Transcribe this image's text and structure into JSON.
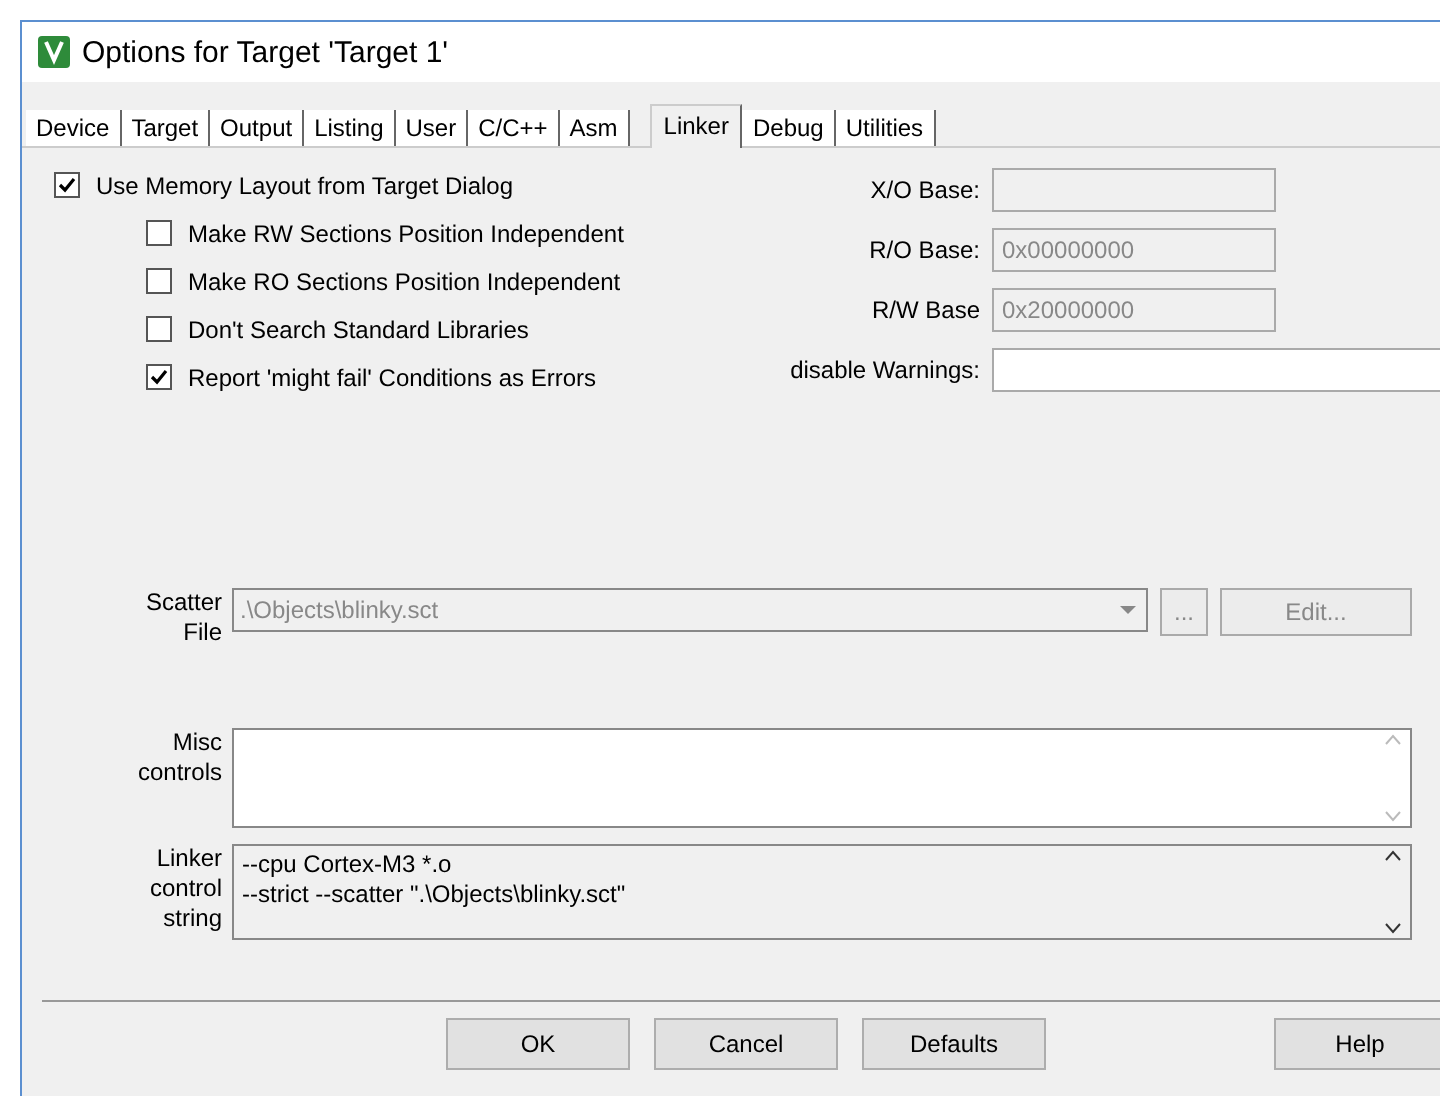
{
  "window": {
    "title": "Options for Target 'Target 1'"
  },
  "tabs": [
    {
      "label": "Device",
      "selected": false
    },
    {
      "label": "Target",
      "selected": false
    },
    {
      "label": "Output",
      "selected": false
    },
    {
      "label": "Listing",
      "selected": false
    },
    {
      "label": "User",
      "selected": false
    },
    {
      "label": "C/C++",
      "selected": false
    },
    {
      "label": "Asm",
      "selected": false
    },
    {
      "label": "Linker",
      "selected": true
    },
    {
      "label": "Debug",
      "selected": false
    },
    {
      "label": "Utilities",
      "selected": false
    }
  ],
  "options": [
    {
      "label": "Use Memory Layout from Target Dialog",
      "checked": true
    },
    {
      "label": "Make RW Sections Position Independent",
      "checked": false
    },
    {
      "label": "Make RO Sections Position Independent",
      "checked": false
    },
    {
      "label": "Don't Search Standard Libraries",
      "checked": false
    },
    {
      "label": "Report 'might fail' Conditions as Errors",
      "checked": true
    }
  ],
  "bases": [
    {
      "label": "X/O Base:",
      "disabled": true
    },
    {
      "label": "R/O Base:",
      "value": "0x00000000",
      "disabled": true
    },
    {
      "label": "R/W Base",
      "value": "0x20000000",
      "disabled": true
    },
    {
      "label": "disable Warnings:",
      "disabled": false
    }
  ],
  "scatter": {
    "label": [
      "Scatter",
      "File"
    ],
    "value": ".\\Objects\\blinky.sct",
    "browse": "...",
    "edit": "Edit..."
  },
  "misc": {
    "label": [
      "Misc",
      "controls"
    ]
  },
  "linker_control": {
    "label": [
      "Linker",
      "control",
      "string"
    ],
    "lines": [
      "--cpu Cortex-M3 *.o",
      "--strict --scatter \".\\Objects\\blinky.sct\""
    ]
  },
  "buttons": [
    {
      "label": "OK",
      "kind": "main"
    },
    {
      "label": "Cancel",
      "kind": "main"
    },
    {
      "label": "Defaults",
      "kind": "main"
    },
    {
      "label": "Help",
      "kind": "help"
    }
  ]
}
